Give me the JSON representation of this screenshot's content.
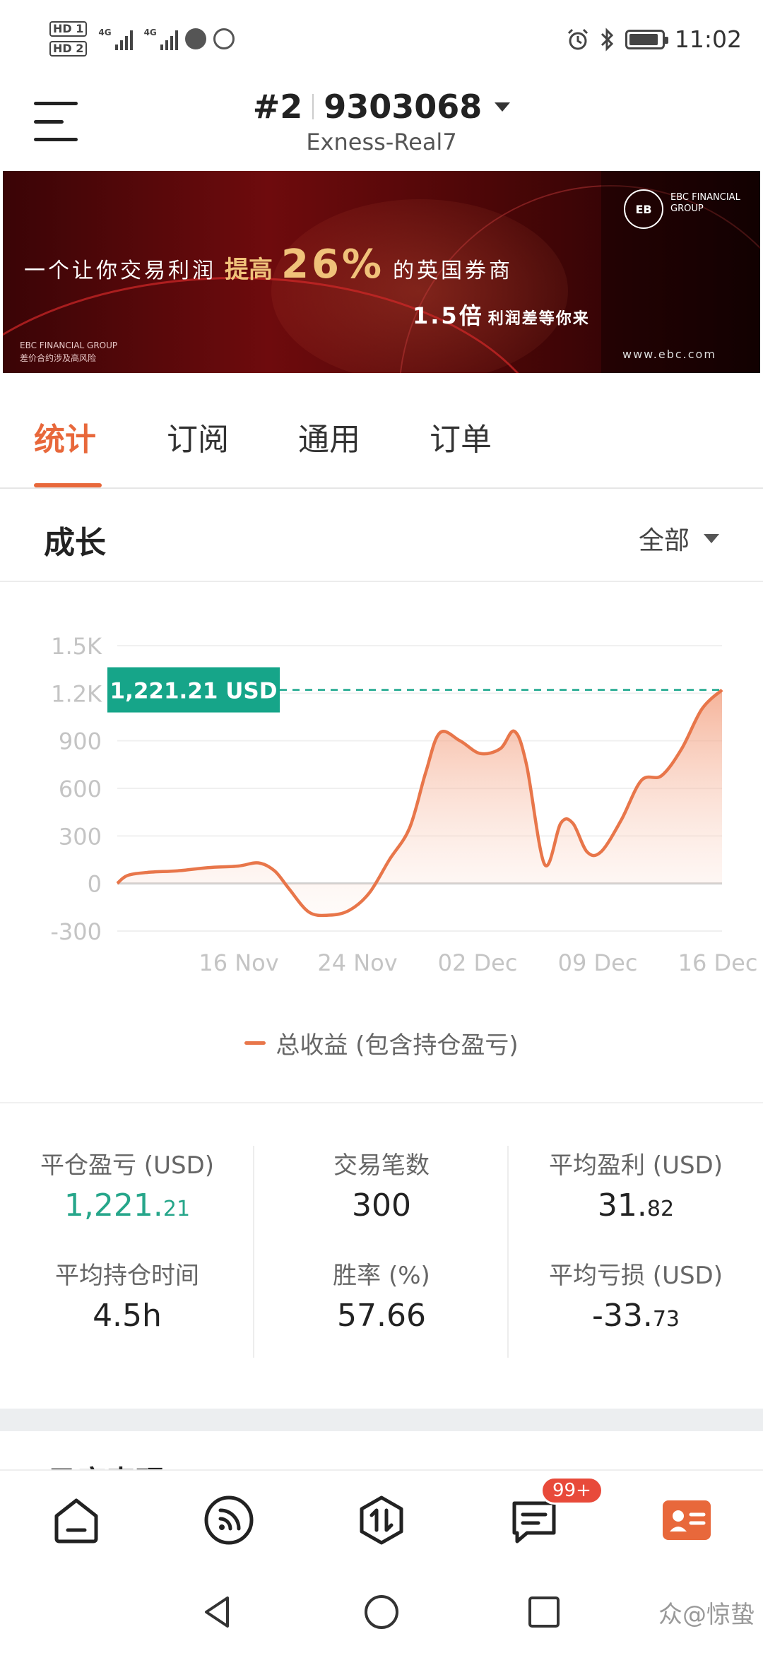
{
  "status_bar": {
    "hd1": "HD 1",
    "hd2": "HD 2",
    "net1": "4G",
    "net2": "4G",
    "time": "11:02"
  },
  "header": {
    "account_prefix": "#2",
    "account_number": "9303068",
    "server": "Exness-Real7"
  },
  "banner": {
    "tagline_a": "一个让你交易利润",
    "tagline_b": "提高",
    "tagline_pct": "26%",
    "tagline_c": "的英国券商",
    "sub_a": "1.5倍",
    "sub_b": "利润差等你来",
    "brand_small": "EBC FINANCIAL GROUP",
    "risk_small": "差价合约涉及高风险",
    "logo_mark": "EB",
    "logo_text": "EBC FINANCIAL GROUP",
    "url": "www.ebc.com"
  },
  "tabs": [
    {
      "label": "统计",
      "active": true
    },
    {
      "label": "订阅",
      "active": false
    },
    {
      "label": "通用",
      "active": false
    },
    {
      "label": "订单",
      "active": false
    }
  ],
  "section": {
    "title": "成长",
    "filter": "全部"
  },
  "chart_data": {
    "type": "area",
    "y_ticks": [
      "1.5K",
      "1.2K",
      "900",
      "600",
      "300",
      "0",
      "-300"
    ],
    "y_tick_values": [
      1500,
      1200,
      900,
      600,
      300,
      0,
      -300
    ],
    "ylim": [
      -300,
      1500
    ],
    "x_ticks": [
      "16 Nov",
      "24 Nov",
      "02 Dec",
      "09 Dec",
      "16 Dec"
    ],
    "series": [
      {
        "name": "总收益 (包含持仓盈亏)",
        "color": "#e8764a",
        "points": [
          [
            0,
            0
          ],
          [
            0.5,
            50
          ],
          [
            1.5,
            70
          ],
          [
            3,
            80
          ],
          [
            4.5,
            100
          ],
          [
            6,
            110
          ],
          [
            7,
            130
          ],
          [
            7.8,
            80
          ],
          [
            8.5,
            -30
          ],
          [
            9.5,
            -180
          ],
          [
            10.5,
            -200
          ],
          [
            11.5,
            -170
          ],
          [
            12.5,
            -60
          ],
          [
            13.5,
            150
          ],
          [
            14.5,
            350
          ],
          [
            15.3,
            700
          ],
          [
            16,
            950
          ],
          [
            17,
            900
          ],
          [
            18,
            820
          ],
          [
            19,
            850
          ],
          [
            19.7,
            960
          ],
          [
            20.3,
            750
          ],
          [
            21.2,
            120
          ],
          [
            22,
            380
          ],
          [
            22.6,
            380
          ],
          [
            23.3,
            200
          ],
          [
            24,
            200
          ],
          [
            25,
            400
          ],
          [
            26,
            650
          ],
          [
            27,
            680
          ],
          [
            28,
            850
          ],
          [
            29,
            1100
          ],
          [
            30,
            1221.21
          ]
        ]
      }
    ],
    "marker_label": "1,221.21 USD",
    "marker_value": 1221.21,
    "marker_color": "#16a589"
  },
  "stats": {
    "col1": [
      {
        "label": "平仓盈亏 (USD)",
        "int": "1,221.",
        "dec": "21",
        "green": true
      },
      {
        "label": "平均持仓时间",
        "int": "4.5h",
        "dec": "",
        "green": false
      }
    ],
    "col2": [
      {
        "label": "交易笔数",
        "int": "300",
        "dec": "",
        "green": false
      },
      {
        "label": "胜率 (%)",
        "int": "57.66",
        "dec": "",
        "green": false
      }
    ],
    "col3": [
      {
        "label": "平均盈利 (USD)",
        "int": "31.",
        "dec": "82",
        "green": false
      },
      {
        "label": "平均亏损 (USD)",
        "int": "-33.",
        "dec": "73",
        "green": false
      }
    ]
  },
  "peek_title": "日度表现",
  "bottom_nav": {
    "badge": "99+"
  },
  "watermark": "众@惊蛰"
}
